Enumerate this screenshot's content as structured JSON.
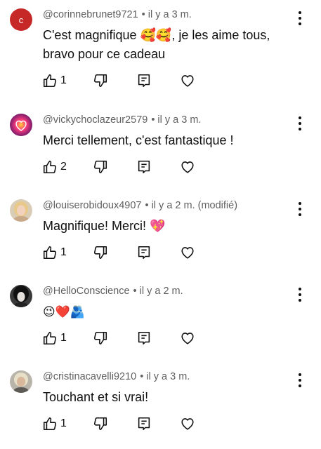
{
  "comments": [
    {
      "avatar_letter": "c",
      "author": "@corinnebrunet9721",
      "separator": "•",
      "time": "il y a 3 m.",
      "text": "C'est magnifique 🥰🥰, je les aime tous, bravo pour ce cadeau",
      "likes": "1"
    },
    {
      "author": "@vickychoclazeur2579",
      "separator": "•",
      "time": "il y a 3 m.",
      "text": "Merci tellement, c'est fantastique !",
      "likes": "2"
    },
    {
      "author": "@louiserobidoux4907",
      "separator": "•",
      "time": "il y a 2 m. (modifié)",
      "text": "Magnifique! Merci! 💖",
      "likes": "1"
    },
    {
      "author": "@HelloConscience",
      "separator": "•",
      "time": "il y a 2 m.",
      "text": "😉❤️🫂",
      "likes": "1"
    },
    {
      "author": "@cristinacavelli9210",
      "separator": "•",
      "time": "il y a 3 m.",
      "text": "Touchant et si vrai!",
      "likes": "1"
    }
  ],
  "icons": {
    "like": "thumbs-up-icon",
    "dislike": "thumbs-down-icon",
    "reply": "reply-icon",
    "heart": "heart-icon",
    "menu": "more-vertical-icon"
  },
  "colors": {
    "avatar_letter_bg": "#c62828",
    "meta_text": "#606060",
    "text": "#0f0f0f"
  }
}
